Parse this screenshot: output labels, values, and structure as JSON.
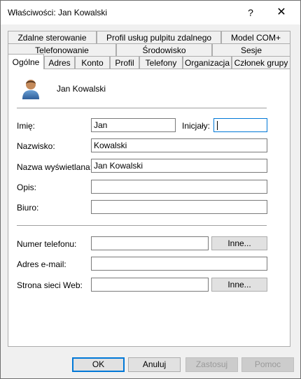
{
  "window": {
    "title": "Właściwości: Jan Kowalski",
    "help_glyph": "?",
    "close_glyph": "✕"
  },
  "tabs": {
    "row1": [
      "Zdalne sterowanie",
      "Profil usług pulpitu zdalnego",
      "Model COM+"
    ],
    "row2": [
      "Telefonowanie",
      "Środowisko",
      "Sesje"
    ],
    "row3": [
      "Ogólne",
      "Adres",
      "Konto",
      "Profil",
      "Telefony",
      "Organizacja",
      "Członek grupy"
    ],
    "active": "Ogólne"
  },
  "general": {
    "user_display": "Jan Kowalski",
    "fields": {
      "first_name": {
        "label": "Imię:",
        "value": "Jan"
      },
      "initials": {
        "label": "Inicjały:",
        "value": ""
      },
      "last_name": {
        "label": "Nazwisko:",
        "value": "Kowalski"
      },
      "display_name": {
        "label": "Nazwa wyświetlana:",
        "value": "Jan Kowalski"
      },
      "description": {
        "label": "Opis:",
        "value": ""
      },
      "office": {
        "label": "Biuro:",
        "value": ""
      },
      "phone": {
        "label": "Numer telefonu:",
        "value": ""
      },
      "email": {
        "label": "Adres e-mail:",
        "value": ""
      },
      "web": {
        "label": "Strona sieci Web:",
        "value": ""
      }
    },
    "other_button": "Inne..."
  },
  "buttons": {
    "ok": "OK",
    "cancel": "Anuluj",
    "apply": "Zastosuj",
    "help": "Pomoc"
  }
}
